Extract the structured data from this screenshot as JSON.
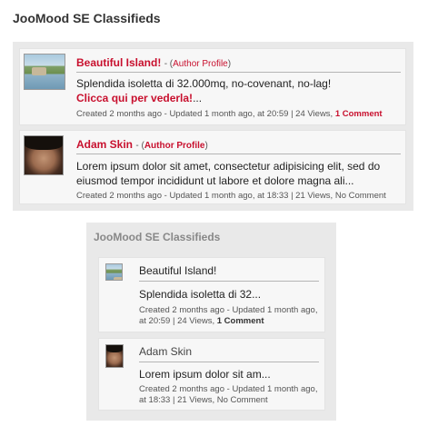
{
  "top_module": {
    "title": "JooMood SE Classifieds",
    "listings": [
      {
        "name": "Beautiful Island!",
        "author_open": "- (",
        "author_link": "Author Profile",
        "author_close": ")",
        "thumb_icon": "island-thumbnail",
        "description": "Splendida isoletta di 32.000mq, no-covenant, no-lag!",
        "read_more": "Clicca qui per vederla!",
        "ellipsis": "...",
        "meta_text": "Created 2 months ago - Updated 1 month ago, at 20:59 | 24 Views,",
        "comments": "1 Comment"
      },
      {
        "name": "Adam Skin",
        "author_open": "- (",
        "author_link": "Author Profile",
        "author_close": ")",
        "thumb_icon": "avatar-face-thumbnail",
        "description_line1": "Lorem ipsum dolor sit amet, consectetur adipisicing elit, sed do",
        "description_line2": "eiusmod tempor incididunt ut labore et dolore magna ali...",
        "meta_text": "Created 2 months ago - Updated 1 month ago, at 18:33 | 21 Views, No Comment"
      }
    ]
  },
  "bottom_module": {
    "title": "JooMood SE Classifieds",
    "listings": [
      {
        "name": "Beautiful Island!",
        "description": "Splendida isoletta di 32...",
        "meta_line1": "Created 2 months ago - Updated 1 month ago,",
        "meta_line2": "at 20:59 | 24 Views,",
        "comments": "1 Comment",
        "thumb_icon": "island-thumbnail"
      },
      {
        "name": "Adam Skin",
        "description": "Lorem ipsum dolor sit am...",
        "meta_line1": "Created 2 months ago - Updated 1 month ago,",
        "meta_line2": "at 18:33 | 21 Views, No Comment",
        "thumb_icon": "avatar-face-thumbnail"
      }
    ]
  },
  "colors": {
    "accent": "#c8102e",
    "panel_bg": "#e9e9e9",
    "card_bg": "#f7f7f7"
  }
}
